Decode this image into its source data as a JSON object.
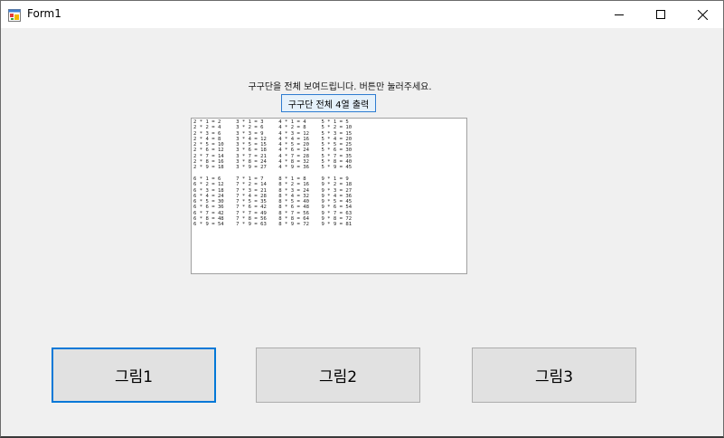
{
  "window": {
    "title": "Form1"
  },
  "instruction": "구구단을 전체 보여드립니다. 버튼만 눌러주세요.",
  "print_button": "구구단 전체 4열 출력",
  "output_lines": [
    "2 * 1 = 2     3 * 1 = 3     4 * 1 = 4     5 * 1 = 5",
    "2 * 2 = 4     3 * 2 = 6     4 * 2 = 8     5 * 2 = 10",
    "2 * 3 = 6     3 * 3 = 9     4 * 3 = 12    5 * 3 = 15",
    "2 * 4 = 8     3 * 4 = 12    4 * 4 = 16    5 * 4 = 20",
    "2 * 5 = 10    3 * 5 = 15    4 * 5 = 20    5 * 5 = 25",
    "2 * 6 = 12    3 * 6 = 18    4 * 6 = 24    5 * 6 = 30",
    "2 * 7 = 14    3 * 7 = 21    4 * 7 = 28    5 * 7 = 35",
    "2 * 8 = 16    3 * 8 = 24    4 * 8 = 32    5 * 8 = 40",
    "2 * 9 = 18    3 * 9 = 27    4 * 9 = 36    5 * 9 = 45",
    "",
    "6 * 1 = 6     7 * 1 = 7     8 * 1 = 8     9 * 1 = 9",
    "6 * 2 = 12    7 * 2 = 14    8 * 2 = 16    9 * 2 = 18",
    "6 * 3 = 18    7 * 3 = 21    8 * 3 = 24    9 * 3 = 27",
    "6 * 4 = 24    7 * 4 = 28    8 * 4 = 32    9 * 4 = 36",
    "6 * 5 = 30    7 * 5 = 35    8 * 5 = 40    9 * 5 = 45",
    "6 * 6 = 36    7 * 6 = 42    8 * 6 = 48    9 * 6 = 54",
    "6 * 7 = 42    7 * 7 = 49    8 * 7 = 56    9 * 7 = 63",
    "6 * 8 = 48    7 * 8 = 56    8 * 8 = 64    9 * 8 = 72",
    "6 * 9 = 54    7 * 9 = 63    8 * 9 = 72    9 * 9 = 81"
  ],
  "picture_buttons": [
    "그림1",
    "그림2",
    "그림3"
  ],
  "icons": {
    "app": "winforms-app-icon",
    "minimize": "minimize-icon",
    "maximize": "maximize-icon",
    "close": "close-icon"
  },
  "colors": {
    "focus_border": "#0078d7",
    "button_face": "#e1e1e1",
    "form_bg": "#f0f0f0"
  }
}
